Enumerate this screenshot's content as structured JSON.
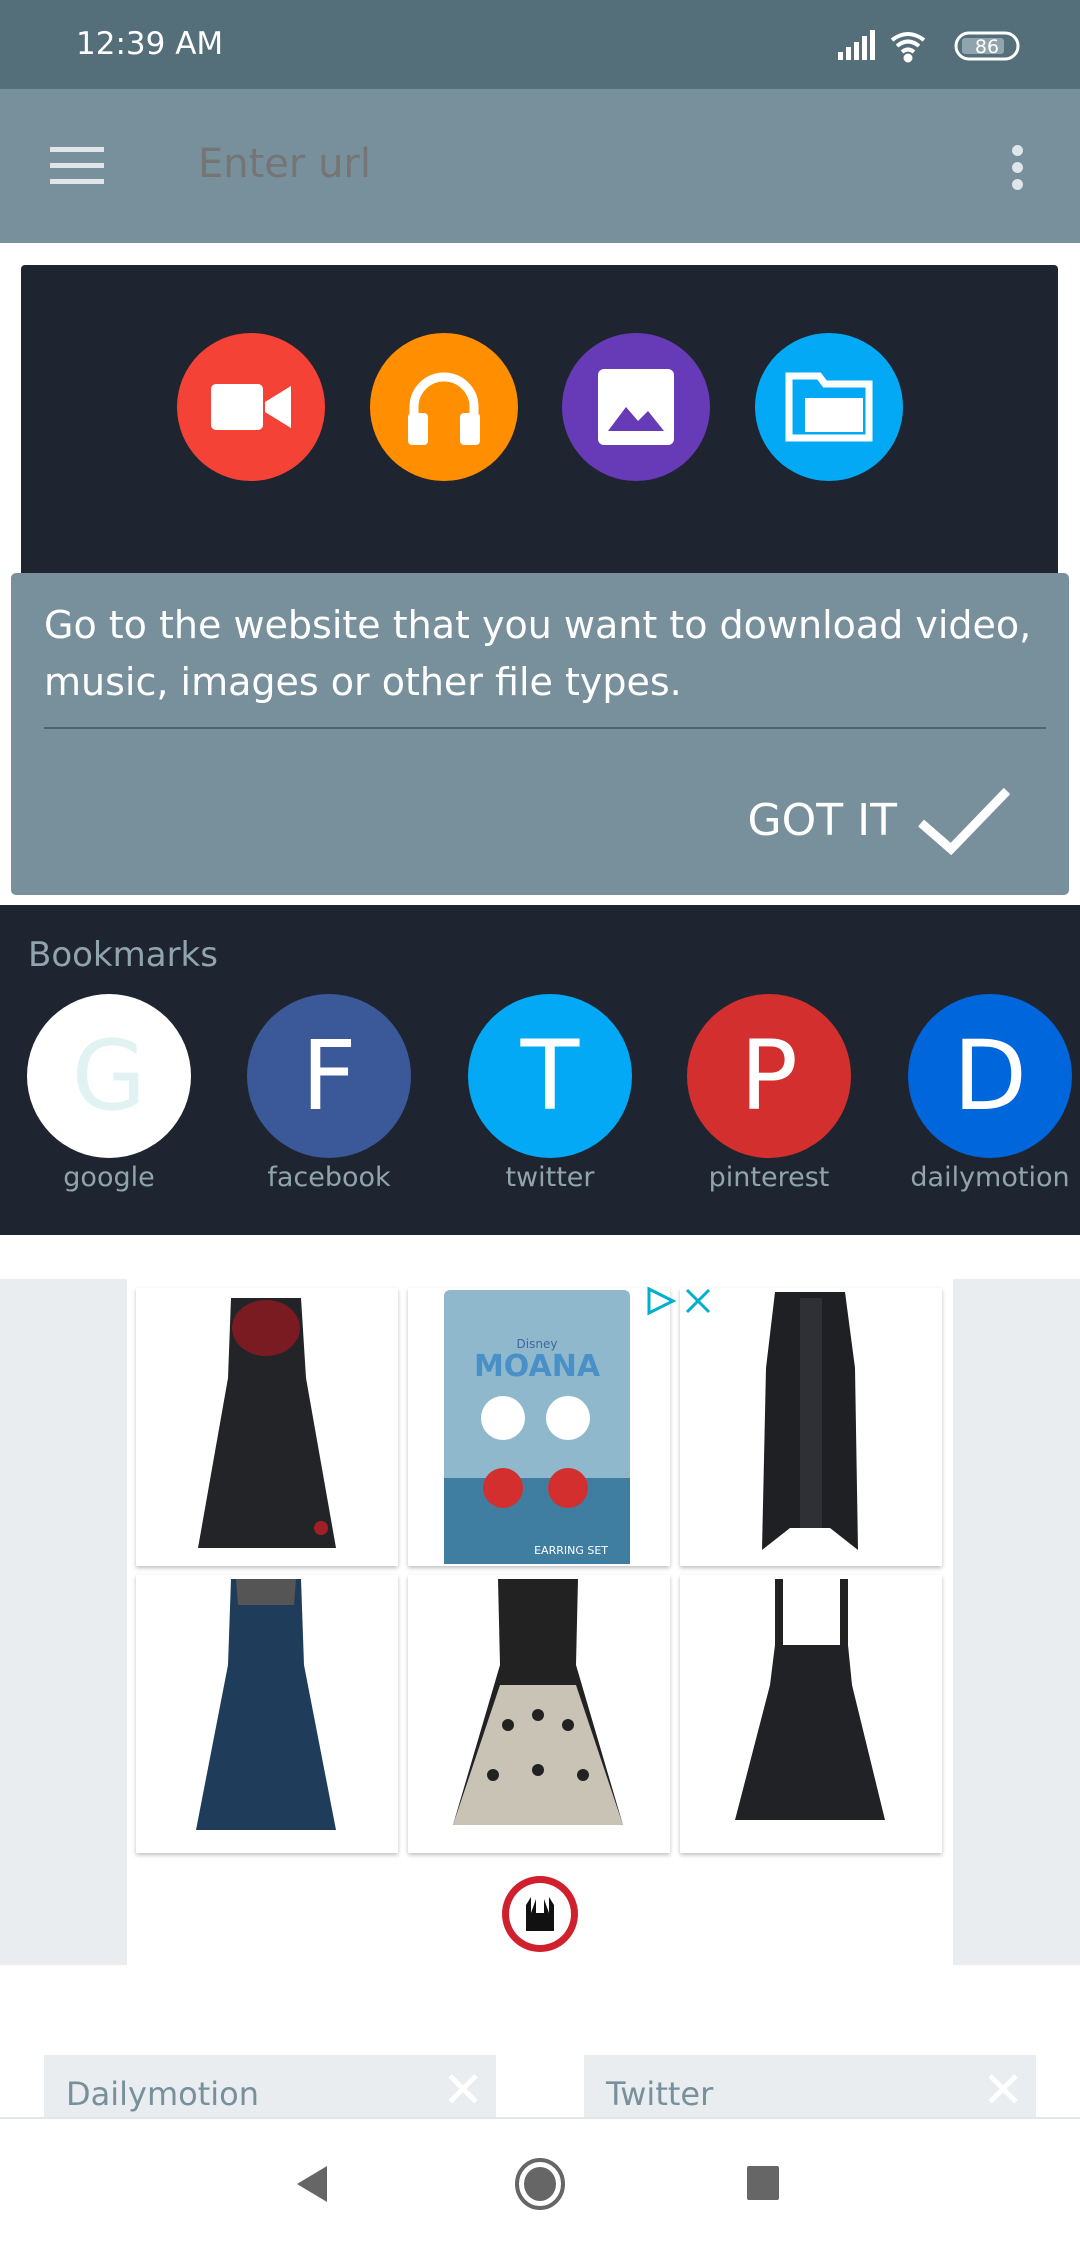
{
  "status": {
    "time": "12:39 AM",
    "battery": "86"
  },
  "toolbar": {
    "url_placeholder": "Enter url"
  },
  "categories": [
    {
      "name": "video",
      "color": "#f44336"
    },
    {
      "name": "music",
      "color": "#ff8f00"
    },
    {
      "name": "images",
      "color": "#673ab7"
    },
    {
      "name": "files",
      "color": "#03a9f4"
    }
  ],
  "tooltip": {
    "message": "Go to the website that you want to download video, music, images or other file types.",
    "button": "GOT IT"
  },
  "bookmarks": {
    "title": "Bookmarks",
    "items": [
      {
        "letter": "G",
        "label": "google",
        "color": "#ffffff",
        "text_color": "#e0f2f1"
      },
      {
        "letter": "F",
        "label": "facebook",
        "color": "#3b5998",
        "text_color": "#ffffff"
      },
      {
        "letter": "T",
        "label": "twitter",
        "color": "#03a9f4",
        "text_color": "#ffffff"
      },
      {
        "letter": "P",
        "label": "pinterest",
        "color": "#d32f2f",
        "text_color": "#ffffff"
      },
      {
        "letter": "D",
        "label": "dailymotion",
        "color": "#0066dc",
        "text_color": "#ffffff"
      }
    ]
  },
  "ad": {
    "products": [
      "black dress with red scarf",
      "Moana earring set",
      "black long vest",
      "blue patterned dress",
      "black and white patterned dress",
      "black pinafore dress"
    ],
    "moana_brand": "Disney",
    "moana_title": "MOANA",
    "moana_caption": "EARRING SET"
  },
  "tabs": [
    {
      "title": "Dailymotion"
    },
    {
      "title": "Twitter"
    }
  ]
}
